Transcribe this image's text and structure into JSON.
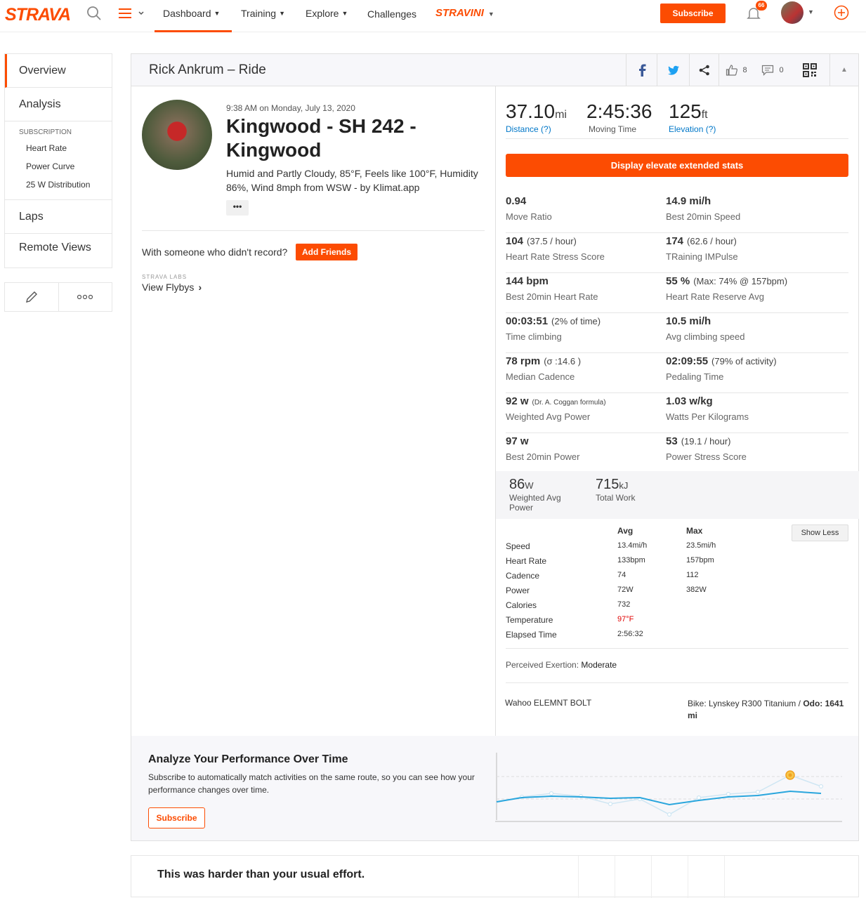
{
  "nav": {
    "logo": "STRAVA",
    "items": [
      "Dashboard",
      "Training",
      "Explore",
      "Challenges"
    ],
    "stravini": "STRAVINI",
    "subscribe": "Subscribe",
    "notifications": "66"
  },
  "sidebar": {
    "overview": "Overview",
    "analysis": "Analysis",
    "subscription_title": "SUBSCRIPTION",
    "sub_items": [
      "Heart Rate",
      "Power Curve",
      "25 W Distribution"
    ],
    "laps": "Laps",
    "remote_views": "Remote Views"
  },
  "header": {
    "title": "Rick Ankrum – Ride",
    "kudos": "8",
    "comments": "0"
  },
  "activity": {
    "date": "9:38 AM on Monday, July 13, 2020",
    "name": "Kingwood - SH 242 - Kingwood",
    "description": "Humid and Partly Cloudy, 85°F, Feels like 100°F, Humidity 86%, Wind 8mph from WSW - by Klimat.app",
    "more": "•••",
    "with_someone": "With someone who didn't record?",
    "add_friends": "Add Friends",
    "labs": "STRAVA LABS",
    "flybys": "View Flybys"
  },
  "stats": {
    "distance": {
      "value": "37.10",
      "unit": "mi",
      "label": "Distance (?)"
    },
    "moving_time": {
      "value": "2:45:36",
      "label": "Moving Time"
    },
    "elevation": {
      "value": "125",
      "unit": "ft",
      "label": "Elevation (?)"
    }
  },
  "elevate_button": "Display elevate extended stats",
  "extended": [
    {
      "value": "0.94",
      "sub": "",
      "label": "Move Ratio"
    },
    {
      "value": "14.9 mi/h",
      "sub": "",
      "label": "Best 20min Speed"
    },
    {
      "value": "104",
      "sub": "(37.5 / hour)",
      "label": "Heart Rate Stress Score"
    },
    {
      "value": "174",
      "sub": "(62.6 / hour)",
      "label": "TRaining IMPulse"
    },
    {
      "value": "144 bpm",
      "sub": "",
      "label": "Best 20min Heart Rate"
    },
    {
      "value": "55 %",
      "sub": "(Max: 74% @ 157bpm)",
      "label": "Heart Rate Reserve Avg"
    },
    {
      "value": "00:03:51",
      "sub": "(2% of time)",
      "label": "Time climbing"
    },
    {
      "value": "10.5 mi/h",
      "sub": "",
      "label": "Avg climbing speed"
    },
    {
      "value": "78 rpm",
      "sub": "(σ :14.6 )",
      "label": "Median Cadence"
    },
    {
      "value": "02:09:55",
      "sub": "(79% of activity)",
      "label": "Pedaling Time"
    },
    {
      "value": "92 w",
      "sub": "(Dr. A. Coggan formula)",
      "label": "Weighted Avg Power"
    },
    {
      "value": "1.03 w/kg",
      "sub": "",
      "label": "Watts Per Kilograms"
    },
    {
      "value": "97 w",
      "sub": "",
      "label": "Best 20min Power"
    },
    {
      "value": "53",
      "sub": "(19.1 / hour)",
      "label": "Power Stress Score"
    }
  ],
  "power": {
    "weighted": {
      "value": "86",
      "unit": "W",
      "label": "Weighted Avg Power"
    },
    "work": {
      "value": "715",
      "unit": "kJ",
      "label": "Total Work"
    }
  },
  "table": {
    "avg_header": "Avg",
    "max_header": "Max",
    "show_less": "Show Less",
    "rows": [
      {
        "name": "Speed",
        "avg": "13.4mi/h",
        "max": "23.5mi/h"
      },
      {
        "name": "Heart Rate",
        "avg": "133bpm",
        "max": "157bpm"
      },
      {
        "name": "Cadence",
        "avg": "74",
        "max": "112"
      },
      {
        "name": "Power",
        "avg": "72W",
        "max": "382W"
      },
      {
        "name": "Calories",
        "avg": "732",
        "max": ""
      },
      {
        "name": "Temperature",
        "avg": "97°F",
        "max": ""
      },
      {
        "name": "Elapsed Time",
        "avg": "2:56:32",
        "max": ""
      }
    ]
  },
  "exertion": {
    "label": "Perceived Exertion:",
    "value": "Moderate"
  },
  "device": "Wahoo ELEMNT BOLT",
  "bike": {
    "label": "Bike: Lynskey R300 Titanium /",
    "odo": "Odo: 1641 mi"
  },
  "analyze": {
    "title": "Analyze Your Performance Over Time",
    "desc": "Subscribe to automatically match activities on the same route, so you can see how your performance changes over time.",
    "subscribe": "Subscribe"
  },
  "harder": {
    "title": "This was harder than your usual effort."
  },
  "colors": {
    "brand": "#fc4c02",
    "link": "#0077c8",
    "temp": "#e00000"
  }
}
